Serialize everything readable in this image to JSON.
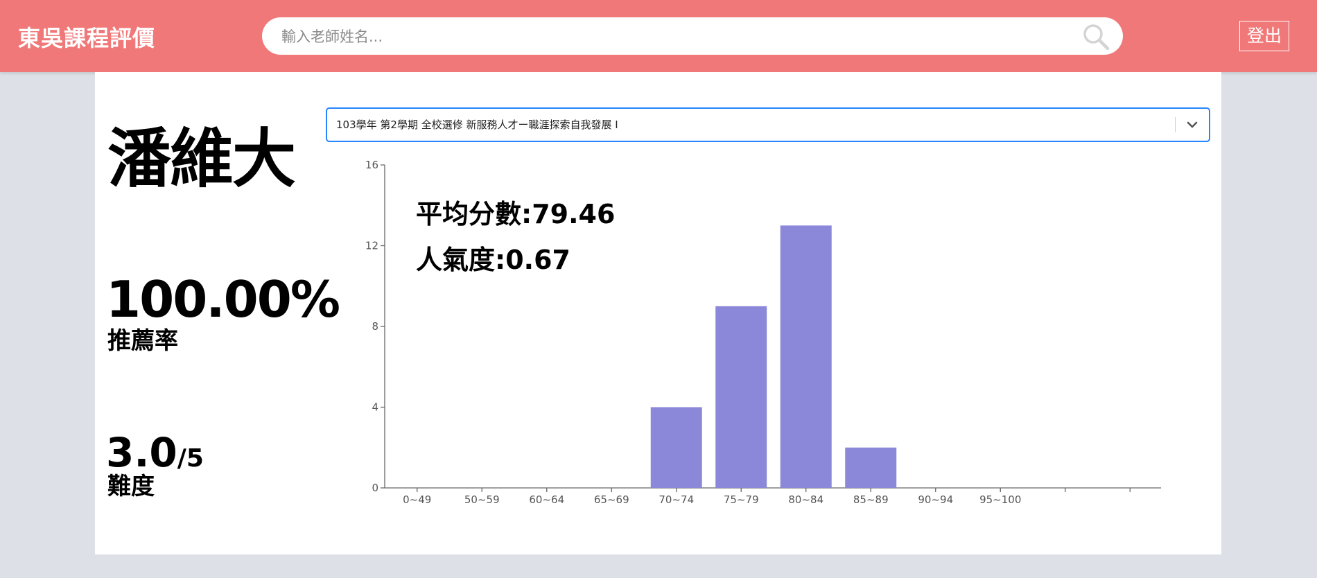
{
  "header": {
    "brand": "東吳課程評價",
    "search_placeholder": "輸入老師姓名...",
    "logout_label": "登出"
  },
  "teacher": {
    "name": "潘維大",
    "recommend_value": "100.00%",
    "recommend_label": "推薦率",
    "difficulty_value": "3.0",
    "difficulty_max": "/5",
    "difficulty_label": "難度"
  },
  "course_select": {
    "selected": "103學年 第2學期 全校選修 新服務人才ー職涯探索自我發展 I"
  },
  "stats": {
    "average": "平均分數:79.46",
    "popularity": "人氣度:0.67"
  },
  "colors": {
    "header": "#f07878",
    "bar": "#8b87d9",
    "select_border": "#2684ff"
  },
  "chart_data": {
    "type": "bar",
    "categories": [
      "0~49",
      "50~59",
      "60~64",
      "65~69",
      "70~74",
      "75~79",
      "80~84",
      "85~89",
      "90~94",
      "95~100",
      "",
      ""
    ],
    "values": [
      0,
      0,
      0,
      0,
      4,
      9,
      13,
      2,
      0,
      0,
      0,
      0
    ],
    "ylim": [
      0,
      16
    ],
    "yticks": [
      0,
      4,
      8,
      12,
      16
    ],
    "grid": false
  }
}
